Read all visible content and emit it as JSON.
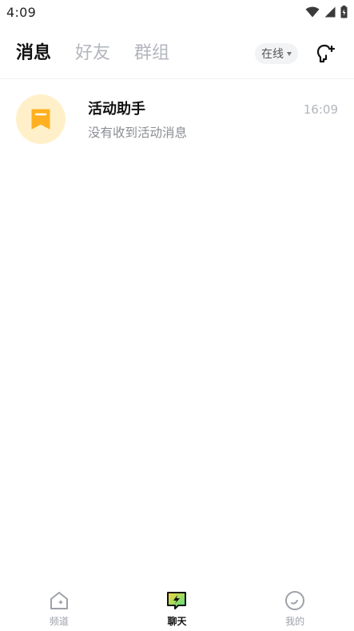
{
  "status_bar": {
    "time": "4:09",
    "icons": [
      "wifi-icon",
      "cell-signal-icon",
      "battery-charging-icon"
    ]
  },
  "header": {
    "tabs": [
      {
        "label": "消息",
        "active": true
      },
      {
        "label": "好友",
        "active": false
      },
      {
        "label": "群组",
        "active": false
      }
    ],
    "status_label": "在线",
    "add_friend_icon": "add-friend-icon"
  },
  "chats": [
    {
      "title": "活动助手",
      "preview": "没有收到活动消息",
      "time": "16:09",
      "avatar_icon": "bookmark-icon",
      "avatar_bg": "#fff0c9",
      "icon_color": "#ffb020"
    }
  ],
  "bottom_nav": [
    {
      "label": "频道",
      "icon": "channel-icon",
      "active": false
    },
    {
      "label": "聊天",
      "icon": "chat-icon",
      "active": true
    },
    {
      "label": "我的",
      "icon": "profile-icon",
      "active": false
    }
  ],
  "colors": {
    "accent_yellow": "#ffb020",
    "inactive_text": "#b3b6bd",
    "active_text": "#111111"
  }
}
